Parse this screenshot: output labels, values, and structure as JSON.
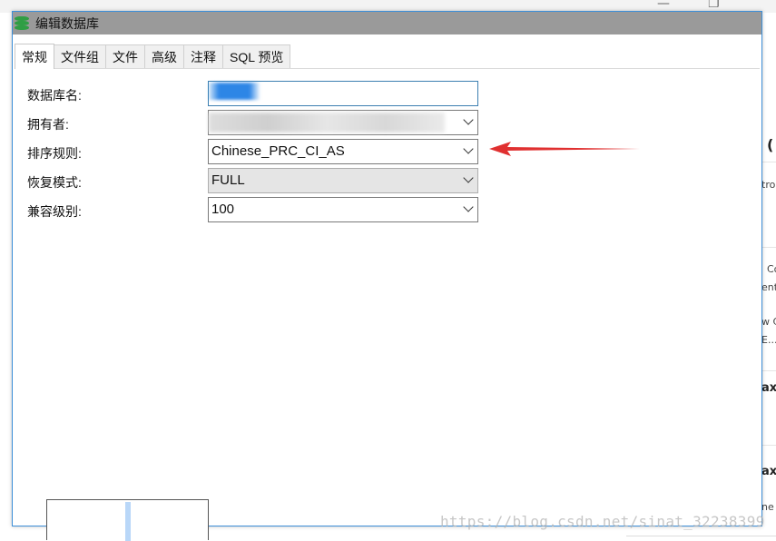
{
  "dialog": {
    "title": "编辑数据库",
    "tabs": [
      "常规",
      "文件组",
      "文件",
      "高级",
      "注释",
      "SQL 预览"
    ],
    "active_tab": "常规"
  },
  "form": {
    "db_name_label": "数据库名:",
    "owner_label": "拥有者:",
    "collation_label": "排序规则:",
    "collation_value": "Chinese_PRC_CI_AS",
    "recovery_label": "恢复模式:",
    "recovery_value": "FULL",
    "compat_label": "兼容级别:",
    "compat_value": "100"
  },
  "background": {
    "fragments": [
      "(",
      "tro",
      "Co",
      "ent",
      "w C",
      "E...",
      "ax",
      "ax",
      "ne"
    ]
  },
  "watermark": "https://blog.csdn.net/sinat_32238399",
  "colors": {
    "titlebar": "#9a9a9a",
    "db_icon": "#2f9e44",
    "arrow": "#e03030",
    "focus_border": "#3c7fb1"
  }
}
